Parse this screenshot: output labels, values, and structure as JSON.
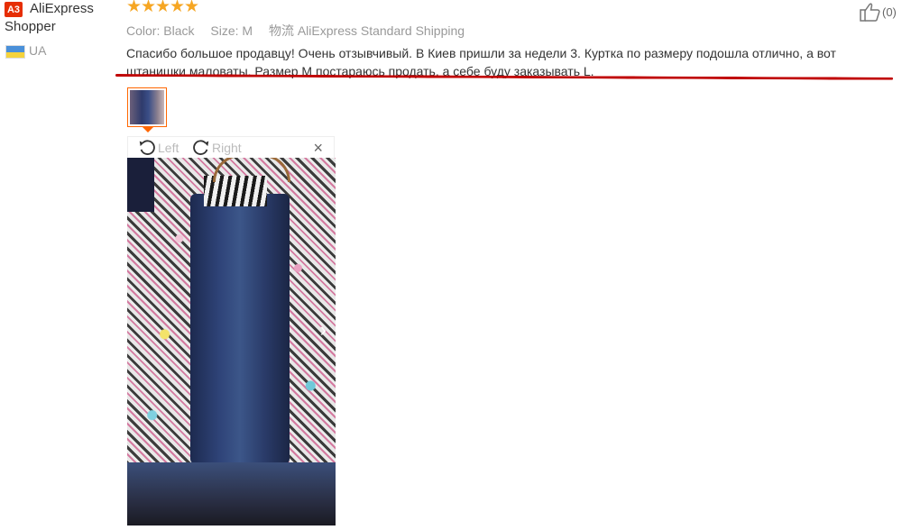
{
  "user": {
    "badge": "A3",
    "name": "AliExpress Shopper",
    "country": "UA",
    "flag_colors": [
      "#4a90d9",
      "#f5d33c"
    ]
  },
  "rating": {
    "stars": 5,
    "of": 5,
    "color": "#f6a623"
  },
  "meta": {
    "color_label": "Color:",
    "color_value": "Black",
    "size_label": "Size:",
    "size_value": "M",
    "shipping_label": "物流",
    "shipping_value": "AliExpress Standard Shipping"
  },
  "review_text": "Спасибо большое продавцу! Очень отзывчивый. В Киев пришли за недели 3. Куртка по размеру подошла отлично, а вот штанишки маловаты. Размер М постараюсь продать, а себе буду заказывать L.",
  "viewer": {
    "rotate_left_label": "Left",
    "rotate_right_label": "Right",
    "close_symbol": "×"
  },
  "helpful": {
    "count_label": "(0)",
    "icon": "thumbs-up-icon"
  },
  "accent_colors": {
    "selected_border": "#ff6600",
    "underline": "#c00000"
  }
}
